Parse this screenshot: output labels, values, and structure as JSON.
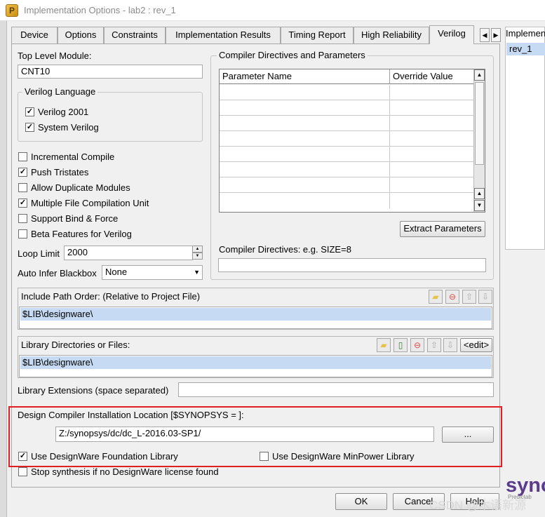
{
  "window": {
    "title": "Implementation Options   -   lab2 : rev_1"
  },
  "tabs": [
    "Device",
    "Options",
    "Constraints",
    "Implementation Results",
    "Timing Report",
    "High Reliability",
    "Verilog"
  ],
  "active_tab": "Verilog",
  "right_panel": {
    "header": "Implemen",
    "item": "rev_1",
    "logo": "syno",
    "logo_sub": "Predictab"
  },
  "top_level": {
    "label": "Top Level Module:",
    "value": "CNT10"
  },
  "verilog_language": {
    "title": "Verilog Language",
    "options": [
      {
        "label": "Verilog 2001",
        "checked": true
      },
      {
        "label": "System Verilog",
        "checked": true
      }
    ]
  },
  "options": [
    {
      "label": "Incremental Compile",
      "checked": false
    },
    {
      "label": "Push Tristates",
      "checked": true
    },
    {
      "label": "Allow Duplicate Modules",
      "checked": false
    },
    {
      "label": "Multiple File Compilation Unit",
      "checked": true
    },
    {
      "label": "Support Bind & Force",
      "checked": false
    },
    {
      "label": "Beta Features for Verilog",
      "checked": false
    }
  ],
  "loop_limit": {
    "label": "Loop Limit",
    "value": "2000"
  },
  "auto_infer": {
    "label": "Auto Infer Blackbox",
    "value": "None"
  },
  "compiler": {
    "title": "Compiler Directives and Parameters",
    "columns": [
      "Parameter Name",
      "Override Value"
    ],
    "extract_button": "Extract Parameters",
    "directives_label": "Compiler Directives: e.g. SIZE=8",
    "directives_value": ""
  },
  "include_path": {
    "label": "Include Path Order: (Relative to Project File)",
    "items": [
      "$LIB\\designware\\"
    ]
  },
  "library_dirs": {
    "label": "Library Directories or Files:",
    "edit_button": "<edit>",
    "items": [
      "$LIB\\designware\\"
    ]
  },
  "library_ext": {
    "label": "Library Extensions (space separated)",
    "value": ""
  },
  "dc_install": {
    "label": "Design Compiler Installation Location [$SYNOPSYS = ]:",
    "value": "Z:/synopsys/dc/dc_L-2016.03-SP1/",
    "browse_button": "...",
    "use_foundation": {
      "label": "Use DesignWare Foundation Library",
      "checked": true
    },
    "use_minpower": {
      "label": "Use DesignWare MinPower Library",
      "checked": false
    }
  },
  "stop_synthesis": {
    "label": "Stop synthesis if no DesignWare license found",
    "checked": false
  },
  "buttons": {
    "ok": "OK",
    "cancel": "Cancel",
    "help": "Help"
  },
  "watermark": "CSDN @木语新源",
  "colors": {
    "highlight_box": "#e02020",
    "selection": "#c6daf3",
    "remove_icon": "#e04848",
    "folder_icon": "#e8c04a",
    "logo": "#5a3b8c"
  }
}
